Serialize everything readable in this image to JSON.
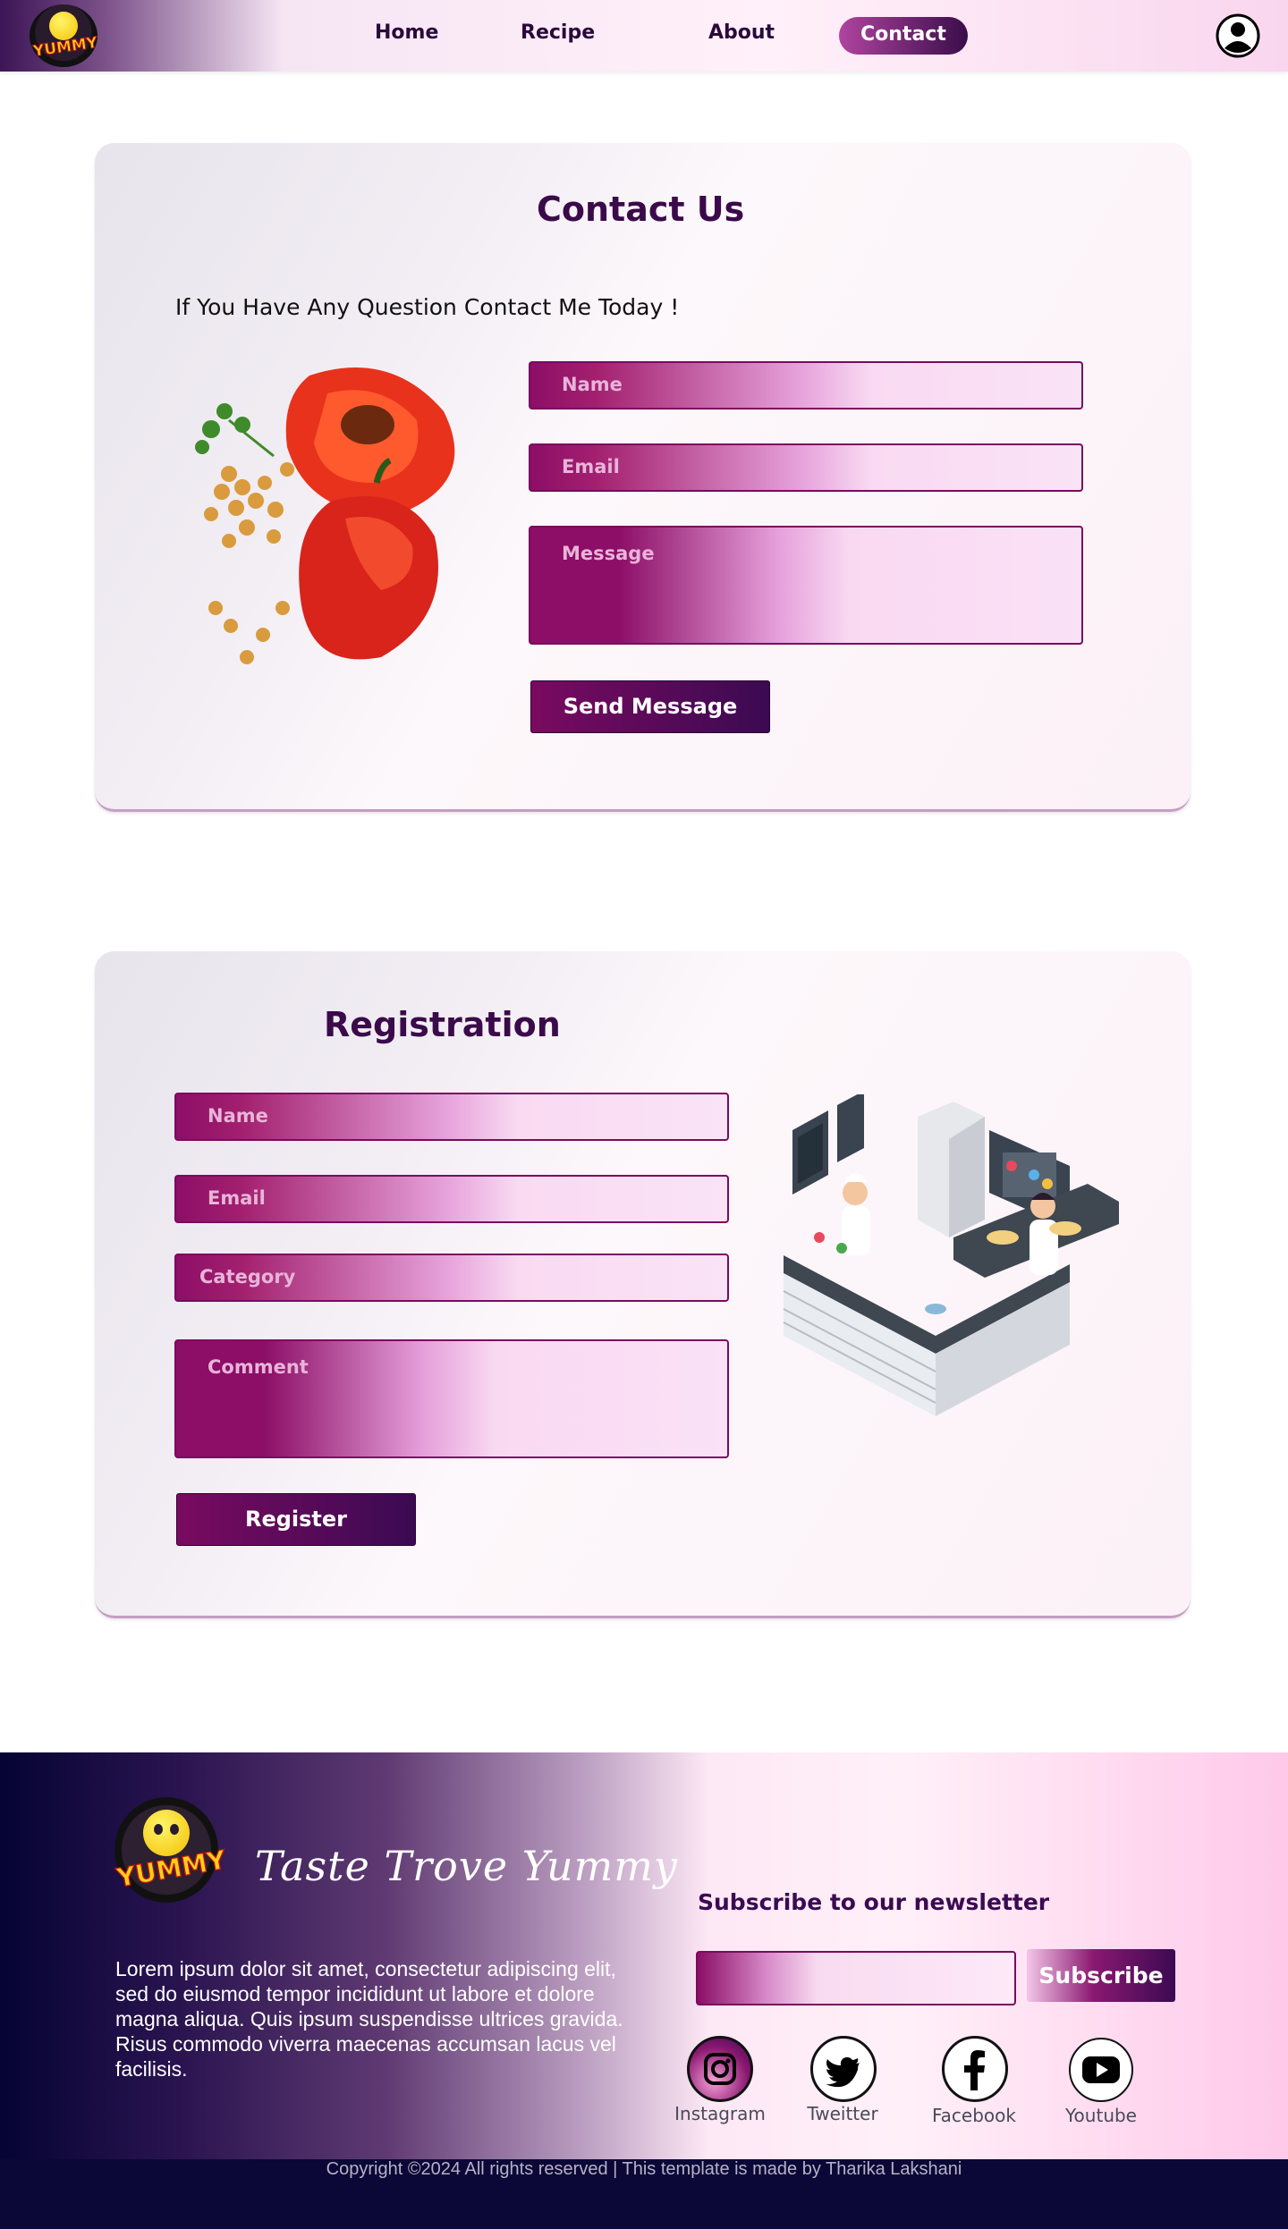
{
  "nav": {
    "logo_text": "YUMMY",
    "links": [
      "Home",
      "Recipe",
      "About",
      "Contact"
    ],
    "active": "Contact"
  },
  "contact": {
    "title": "Contact Us",
    "subtitle": "If You Have Any Question Contact Me Today !",
    "name_placeholder": "Name",
    "email_placeholder": "Email",
    "message_placeholder": "Message",
    "button": "Send Message"
  },
  "registration": {
    "title": "Registration",
    "name_placeholder": "Name",
    "email_placeholder": "Email",
    "category_placeholder": "Category",
    "comment_placeholder": "Comment",
    "button": "Register"
  },
  "footer": {
    "logo_text": "YUMMY",
    "brand": "Taste Trove Yummy",
    "description": "Lorem ipsum dolor sit amet, consectetur adipiscing elit, sed do eiusmod tempor incididunt ut labore et dolore magna aliqua. Quis ipsum suspendisse ultrices gravida. Risus commodo viverra maecenas accumsan lacus vel facilisis.",
    "newsletter_title": "Subscribe to our newsletter",
    "subscribe_button": "Subscribe",
    "social": [
      "Instagram",
      "Tweitter",
      "Facebook",
      "Youtube"
    ],
    "copyright": "Copyright ©2024 All rights reserved | This template is made by Tharika Lakshani"
  },
  "colors": {
    "primary": "#3b0a52",
    "accent": "#8c0e66",
    "footer_bar": "#0b0736"
  }
}
